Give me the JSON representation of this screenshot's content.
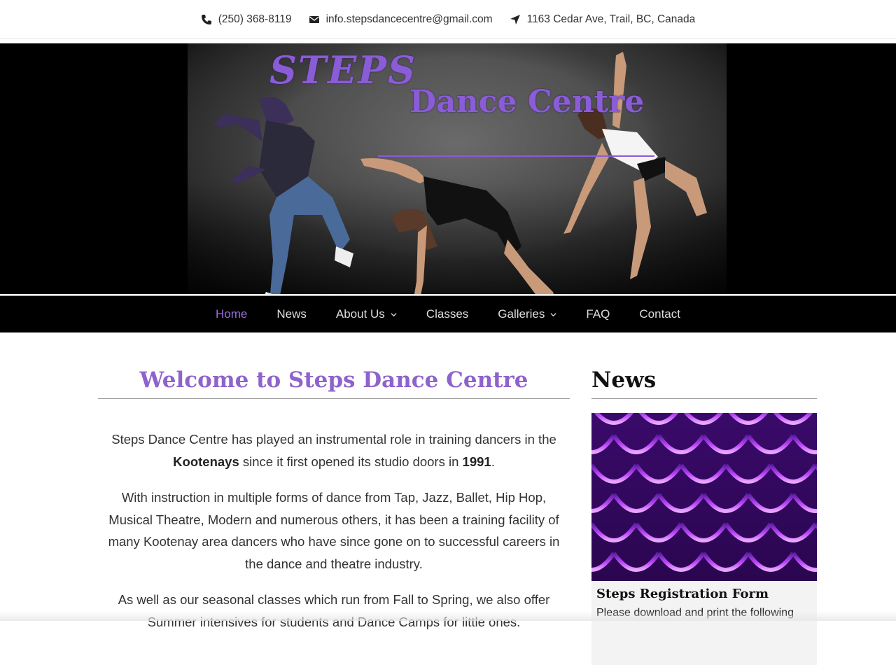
{
  "contact": {
    "phone": "(250) 368-8119",
    "email": "info.stepsdancecentre@gmail.com",
    "address": "1163 Cedar Ave, Trail, BC, Canada"
  },
  "banner": {
    "logo_steps": "STEPS",
    "logo_dance": "Dance Centre"
  },
  "nav": {
    "items": [
      {
        "label": "Home"
      },
      {
        "label": "News"
      },
      {
        "label": "About Us"
      },
      {
        "label": "Classes"
      },
      {
        "label": "Galleries"
      },
      {
        "label": "FAQ"
      },
      {
        "label": "Contact"
      }
    ]
  },
  "main": {
    "title": "Welcome to Steps Dance Centre",
    "p1_a": "Steps Dance Centre has played an instrumental role in training dancers in the ",
    "p1_b": "Kootenays",
    "p1_c": " since it first opened its studio doors in ",
    "p1_d": "1991",
    "p1_e": ".",
    "p2": "With instruction in multiple forms of dance from Tap, Jazz, Ballet, Hip Hop, Musical Theatre, Modern and numerous others, it has been a training facility of many Kootenay area dancers who have since gone on to successful careers in the dance and theatre industry.",
    "p3": "As well as our seasonal classes which run from Fall to Spring, we also offer Summer intensives for students and Dance Camps for little ones."
  },
  "sidebar": {
    "heading": "News",
    "post_title": "Steps Registration Form",
    "post_excerpt": "Please download and print the following"
  },
  "colors": {
    "accent": "#8e63cc",
    "nav_bg": "#000000"
  }
}
